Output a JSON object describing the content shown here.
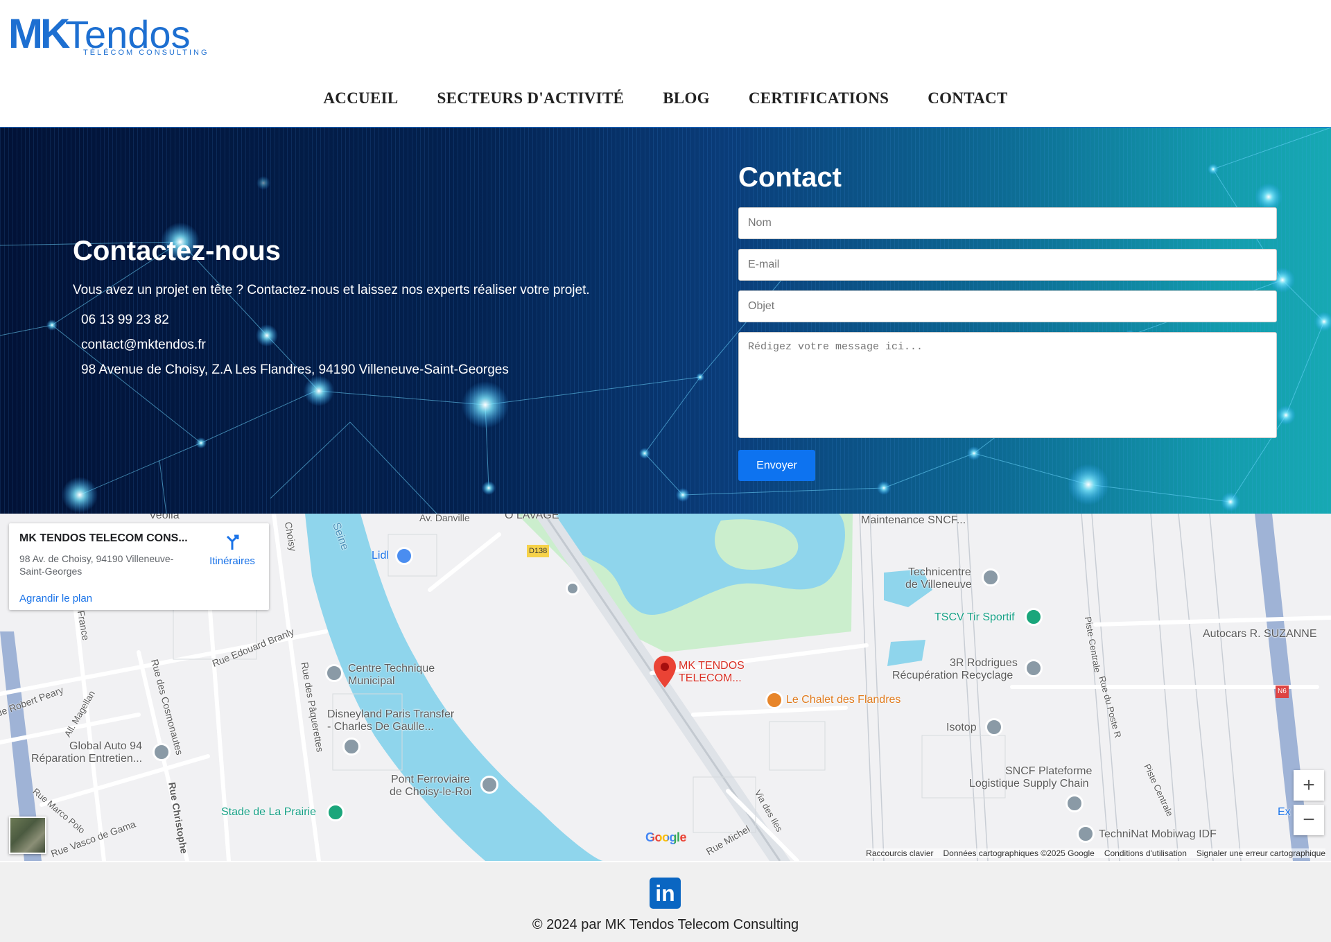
{
  "logo": {
    "brand_mk": "MK",
    "brand_tendos": "Tendos",
    "tagline": "TÉLÉCOM CONSULTING",
    "colors": {
      "blue": "#1d6fd1",
      "green": "#6bbf3a"
    }
  },
  "nav": {
    "items": [
      {
        "label": "ACCUEIL"
      },
      {
        "label": "SECTEURS D'ACTIVITÉ"
      },
      {
        "label": "BLOG"
      },
      {
        "label": "CERTIFICATIONS"
      },
      {
        "label": "CONTACT"
      }
    ]
  },
  "hero": {
    "title": "Contactez-nous",
    "text": "Vous avez un projet en tête ? Contactez-nous et laissez nos experts réaliser votre projet.",
    "phone": "06 13 99 23 82",
    "email": "contact@mktendos.fr",
    "address": "98 Avenue de Choisy, Z.A Les Flandres, 94190 Villeneuve-Saint-Georges"
  },
  "form": {
    "title": "Contact",
    "name_placeholder": "Nom",
    "email_placeholder": "E-mail",
    "subject_placeholder": "Objet",
    "message_placeholder": "Rédigez votre message ici...",
    "submit_label": "Envoyer",
    "submit_color": "#0d73f0"
  },
  "map": {
    "card": {
      "title": "MK TENDOS TELECOM CONS...",
      "address": "98 Av. de Choisy, 94190 Villeneuve-Saint-Georges",
      "enlarge_link": "Agrandir le plan",
      "directions_label": "Itinéraires"
    },
    "labels": {
      "veolia": "Veolia",
      "av_danville": "Av. Danville",
      "o_lavage": "O LAVAGE",
      "maintenance": "Maintenance SNCF...",
      "seine": "Seine",
      "choisy": "Choisy",
      "lidl": "Lidl",
      "d138": "D138",
      "technicentre_1": "Technicentre",
      "technicentre_2": "de Villeneuve",
      "tscv": "TSCV Tir Sportif",
      "autocars": "Autocars R. SUZANNE",
      "rue_branly": "Rue Edouard Branly",
      "france": "le France",
      "centre_tech_1": "Centre Technique",
      "centre_tech_2": "Municipal",
      "mk_pin_1": "MK TENDOS",
      "mk_pin_2": "TELECOM...",
      "rodrigues_1": "3R Rodrigues",
      "rodrigues_2": "Récupération Recyclage",
      "chalet": "Le Chalet des Flandres",
      "robert_peary": "ue Robert Peary",
      "magellan": "All. Magellan",
      "cosmonautes": "Rue des Cosmonautes",
      "paquerettes": "Rue des Pâquerettes",
      "disneyland_1": "Disneyland Paris Transfer",
      "disneyland_2": "- Charles De Gaulle...",
      "isotop": "Isotop",
      "piste_centrale": "Piste Centrale",
      "rue_poste": "Rue du Poste R",
      "n6": "N6",
      "global_1": "Global Auto 94",
      "global_2": "Réparation Entretien...",
      "pont_1": "Pont Ferroviaire",
      "pont_2": "de Choisy-le-Roi",
      "sncf_1": "SNCF Plateforme",
      "sncf_2": "Logistique Supply Chain",
      "marco_polo": "Rue Marco Polo",
      "vasco": "Rue Vasco de Gama",
      "christophe": "Rue Christophe",
      "prairie": "Stade de La Prairie",
      "iles": "Via des Iles",
      "rue_michel": "Rue Michel",
      "techninat": "TechniNat Mobiwag IDF",
      "piste_centrale_2": "Piste Centrale",
      "ex": "Ex"
    },
    "zoom_in": "+",
    "zoom_out": "−",
    "google": "Google",
    "footer": {
      "shortcuts": "Raccourcis clavier",
      "data": "Données cartographiques ©2025 Google",
      "terms": "Conditions d'utilisation",
      "report": "Signaler une erreur cartographique"
    }
  },
  "footer": {
    "linkedin_icon": "in",
    "copyright": "© 2024 par MK Tendos Telecom Consulting"
  }
}
